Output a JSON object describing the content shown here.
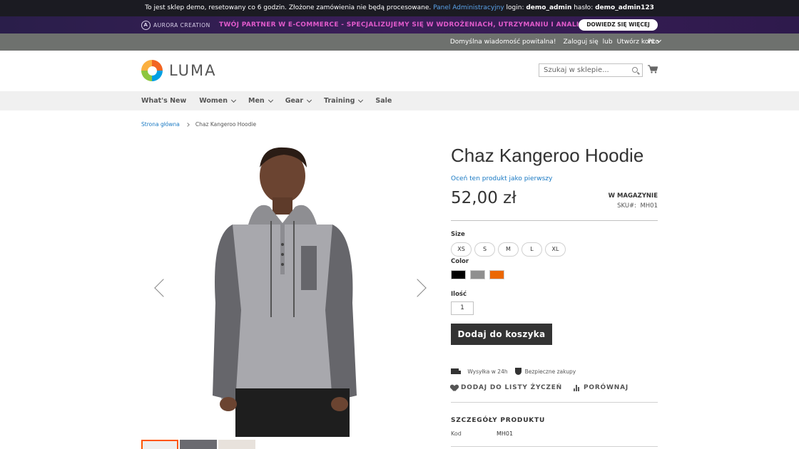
{
  "demo_notice": {
    "text_before": "To jest sklep demo, resetowany co 6 godzin. Złożone zamówienia nie będą procesowane. ",
    "admin_link": "Panel Administracyjny",
    "login_label": " login: ",
    "login": "demo_admin",
    "password_label": " hasło: ",
    "password": "demo_admin123"
  },
  "partner_bar": {
    "brand": "AURORA CREATION",
    "brand_initial": "A",
    "tagline": "TWÓJ PARTNER W E-COMMERCE - SPECJALIZUJEMY SIĘ W WDROŻENIACH, UTRZYMANIU I ANALIZIE MAGENTO",
    "button": "DOWIEDZ SIĘ WIĘCEJ"
  },
  "panel": {
    "welcome": "Domyślna wiadomość powitalna!",
    "login": "Zaloguj się",
    "or": "lub",
    "create_account": "Utwórz konto",
    "language": "PL"
  },
  "header": {
    "logo_text": "LUMA",
    "search_placeholder": "Szukaj w sklepie..."
  },
  "nav": {
    "items": [
      {
        "label": "What's New"
      },
      {
        "label": "Women"
      },
      {
        "label": "Men"
      },
      {
        "label": "Gear"
      },
      {
        "label": "Training"
      },
      {
        "label": "Sale"
      }
    ]
  },
  "breadcrumb": {
    "home": "Strona główna",
    "current": "Chaz Kangeroo Hoodie"
  },
  "product": {
    "title": "Chaz Kangeroo Hoodie",
    "review_link": "Oceń ten produkt jako pierwszy",
    "price": "52,00 zł",
    "stock": "W MAGAZYNIE",
    "sku_label": "SKU#:",
    "sku": "MH01",
    "size_label": "Size",
    "sizes": [
      "XS",
      "S",
      "M",
      "L",
      "XL"
    ],
    "color_label": "Color",
    "colors": [
      "#000000",
      "#8f8f8f",
      "#eb6703"
    ],
    "qty_label": "Ilość",
    "qty": "1",
    "add_to_cart": "Dodaj do koszyka",
    "shipping": "Wysyłka w 24h",
    "secure": "Bezpieczne zakupy",
    "wishlist": "DODAJ DO LISTY ŻYCZEŃ",
    "compare": "PORÓWNAJ",
    "details_title": "SZCZEGÓŁY PRODUKTU",
    "details_key": "Kod",
    "details_value": "MH01"
  },
  "colors": {
    "link": "#1979c3",
    "partner_accent": "#e05acb",
    "thumb_active": "#ff5501",
    "button_dark": "#333333"
  }
}
